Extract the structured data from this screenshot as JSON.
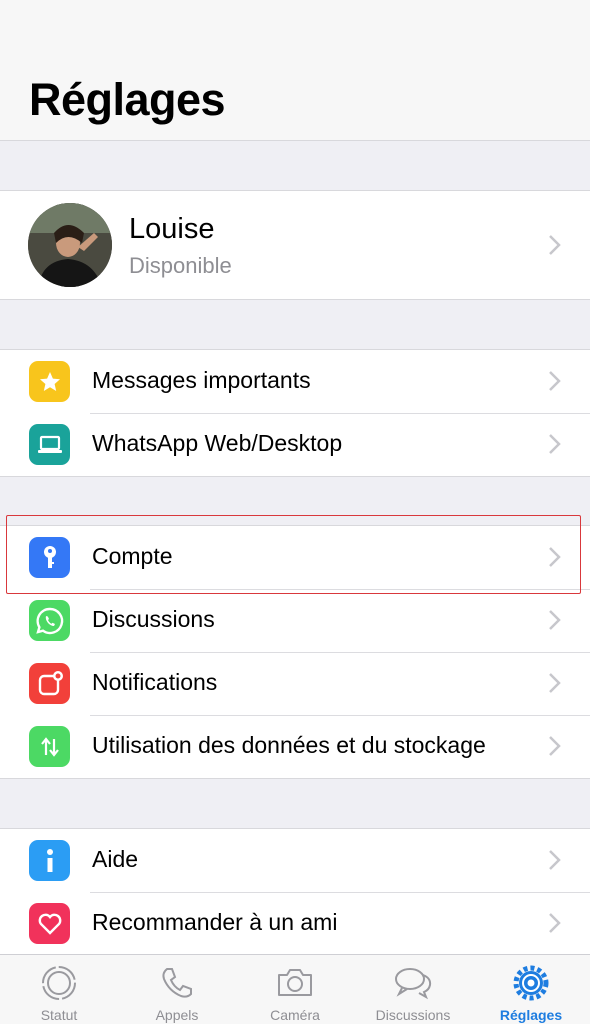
{
  "header": {
    "title": "Réglages"
  },
  "profile": {
    "name": "Louise",
    "status": "Disponible"
  },
  "groups": [
    {
      "items": [
        {
          "label": "Messages importants",
          "icon": "star-icon",
          "color": "#f8c51c"
        },
        {
          "label": "WhatsApp Web/Desktop",
          "icon": "laptop-icon",
          "color": "#1aa39a"
        }
      ]
    },
    {
      "items": [
        {
          "label": "Compte",
          "icon": "key-icon",
          "color": "#3478f6"
        },
        {
          "label": "Discussions",
          "icon": "whatsapp-icon",
          "color": "#4cd964"
        },
        {
          "label": "Notifications",
          "icon": "notification-icon",
          "color": "#f2403a"
        },
        {
          "label": "Utilisation des données et du stockage",
          "icon": "data-transfer-icon",
          "color": "#4cd964"
        }
      ]
    },
    {
      "items": [
        {
          "label": "Aide",
          "icon": "info-icon",
          "color": "#2b9df4"
        },
        {
          "label": "Recommander à un ami",
          "icon": "heart-icon",
          "color": "#f1325b"
        }
      ]
    }
  ],
  "tabbar": {
    "tabs": [
      {
        "label": "Statut",
        "icon": "status-icon",
        "active": false
      },
      {
        "label": "Appels",
        "icon": "phone-icon",
        "active": false
      },
      {
        "label": "Caméra",
        "icon": "camera-icon",
        "active": false
      },
      {
        "label": "Discussions",
        "icon": "chat-bubbles-icon",
        "active": false
      },
      {
        "label": "Réglages",
        "icon": "settings-gear-icon",
        "active": true
      }
    ],
    "active_color": "#1e7de0",
    "inactive_color": "#8e8e93"
  }
}
